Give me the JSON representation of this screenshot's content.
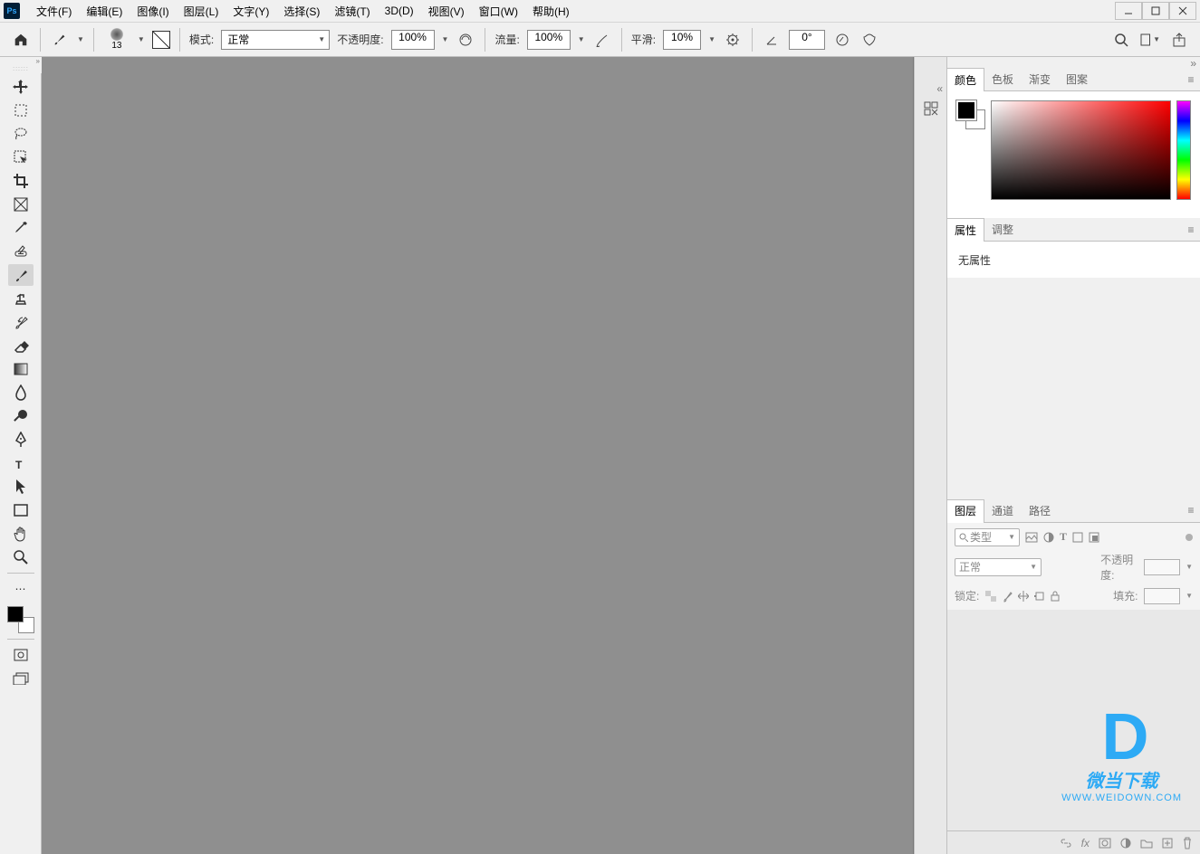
{
  "app": {
    "logo": "Ps"
  },
  "menu": {
    "file": "文件(F)",
    "edit": "编辑(E)",
    "image": "图像(I)",
    "layer": "图层(L)",
    "type": "文字(Y)",
    "select": "选择(S)",
    "filter": "滤镜(T)",
    "threeD": "3D(D)",
    "view": "视图(V)",
    "window": "窗口(W)",
    "help": "帮助(H)"
  },
  "options": {
    "brush_size": "13",
    "mode_label": "模式:",
    "mode_value": "正常",
    "opacity_label": "不透明度:",
    "opacity_value": "100%",
    "flow_label": "流量:",
    "flow_value": "100%",
    "smooth_label": "平滑:",
    "smooth_value": "10%",
    "angle_value": "0°"
  },
  "panels": {
    "color_tabs": {
      "color": "颜色",
      "swatches": "色板",
      "gradients": "渐变",
      "patterns": "图案"
    },
    "props_tabs": {
      "properties": "属性",
      "adjustments": "调整"
    },
    "props_body": "无属性",
    "layers_tabs": {
      "layers": "图层",
      "channels": "通道",
      "paths": "路径"
    },
    "layers": {
      "kind_placeholder": "类型",
      "blend_mode": "正常",
      "opacity_label": "不透明度:",
      "lock_label": "锁定:",
      "fill_label": "填充:"
    }
  },
  "watermark": {
    "logo": "D",
    "text": "微当下载",
    "url": "WWW.WEIDOWN.COM"
  }
}
